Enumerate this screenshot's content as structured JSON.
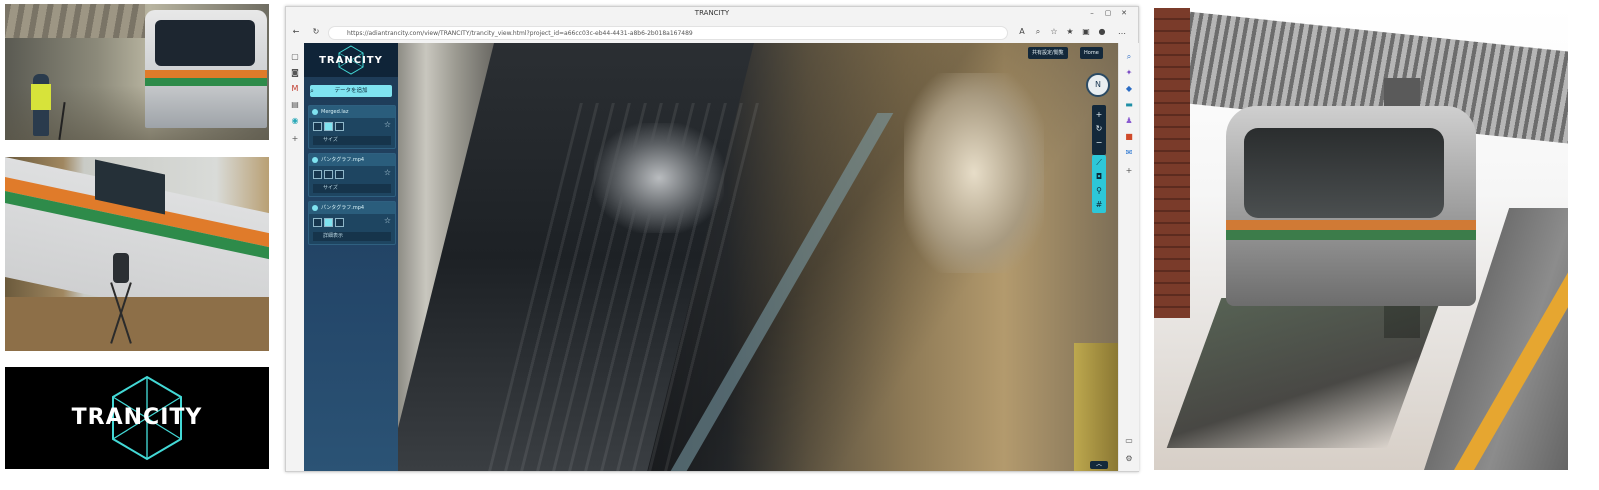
{
  "logo_text": "TRANCITY",
  "browser": {
    "window_title": "TRANCITY",
    "url": "https://adiantrancity.com/view/TRANCITY/trancity_view.html?project_id=a66cc03c-eb44-4431-a8b6-2b018a167489",
    "controls": {
      "minimize": "–",
      "maximize": "▢",
      "close": "✕"
    }
  },
  "app": {
    "panel_logo": "TRANCITY",
    "add_data_label": "データを追加",
    "data_items": [
      {
        "name": "Merged.laz",
        "sub_label": "サイズ"
      },
      {
        "name": "パンタグラフ.mp4",
        "sub_label": "サイズ"
      },
      {
        "name": "パンタグラフ.mp4",
        "sub_label": "詳細表示"
      }
    ],
    "header_buttons": [
      "共有設定/閲覧",
      "Home"
    ],
    "compass_label": "N",
    "zoom_in": "+",
    "zoom_out": "−",
    "tool_icons": [
      "ruler-icon",
      "camera-icon",
      "pin-icon",
      "grid-icon"
    ]
  },
  "accent_color": "#7fe3f0",
  "panel_color": "#1d3a55"
}
